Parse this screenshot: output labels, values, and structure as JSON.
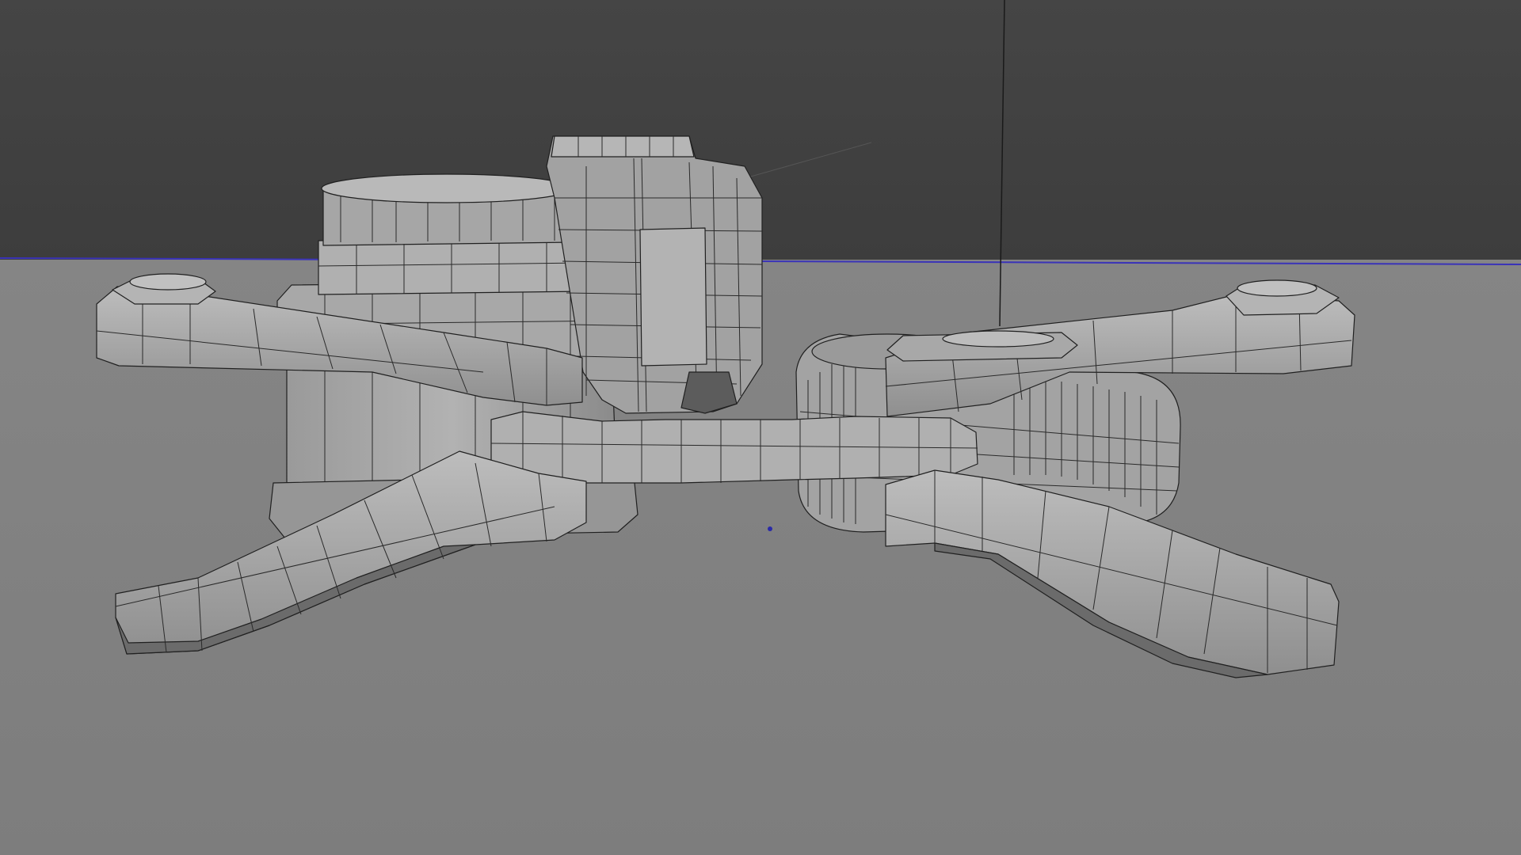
{
  "viewport": {
    "background_top": "#414141",
    "background_bottom": "#808080",
    "horizon_color": "#3a33b8",
    "vertical_axis_color": "#1a1a1a",
    "origin_color": "#2a2aa8",
    "mesh_fill": "#a9a9a9",
    "mesh_shadow": "#5f5f5f",
    "mesh_highlight": "#c2c2c2",
    "wire_color": "#202020",
    "mode": "wireframe-overlay",
    "model": "quadcopter-drone-frame"
  }
}
